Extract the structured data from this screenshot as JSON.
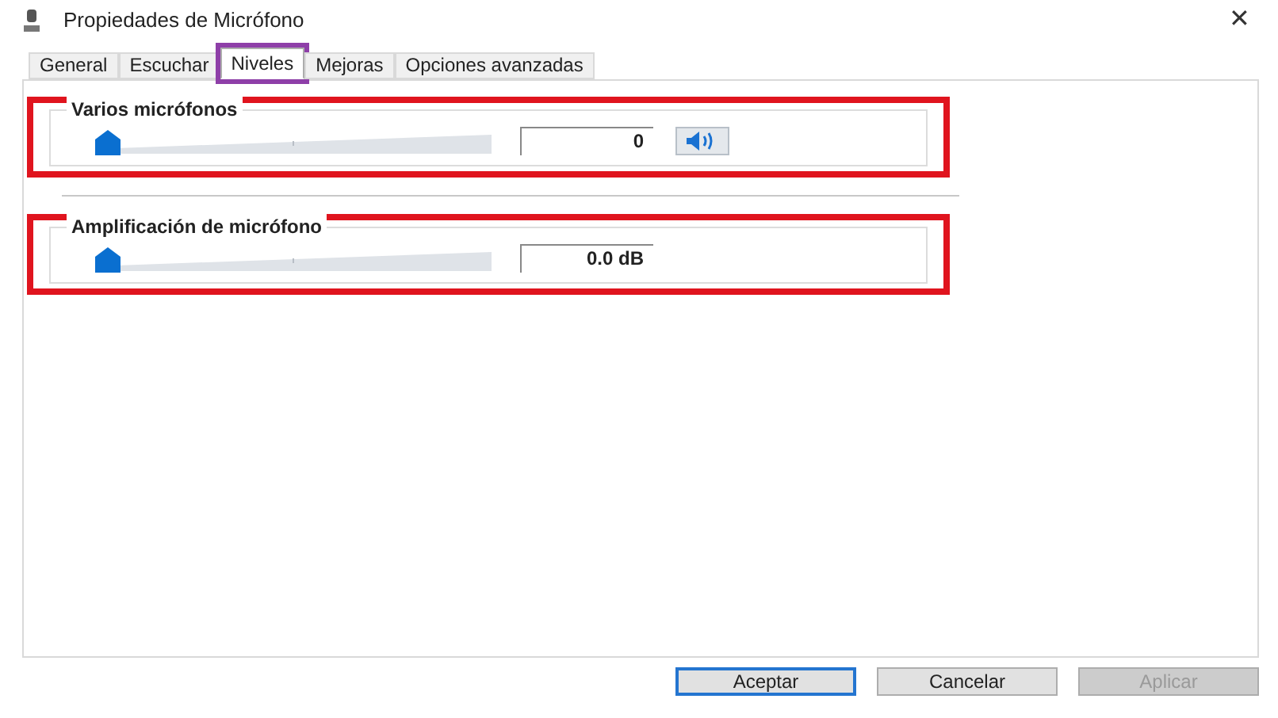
{
  "window": {
    "title": "Propiedades de Micrófono",
    "close": "✕"
  },
  "tabs": [
    {
      "label": "General",
      "selected": false,
      "highlighted": false
    },
    {
      "label": "Escuchar",
      "selected": false,
      "highlighted": false
    },
    {
      "label": "Niveles",
      "selected": true,
      "highlighted": true
    },
    {
      "label": "Mejoras",
      "selected": false,
      "highlighted": false
    },
    {
      "label": "Opciones avanzadas",
      "selected": false,
      "highlighted": false
    }
  ],
  "levels": [
    {
      "label": "Varios micrófonos",
      "level": 0,
      "reading": "0",
      "mute_button": true,
      "highlighted": true
    },
    {
      "label": "Amplificación de micrófono",
      "level": 0,
      "reading": "0.0 dB",
      "mute_button": false,
      "highlighted": true
    }
  ],
  "buttons": [
    {
      "label": "Aceptar",
      "default": true,
      "disabled": false
    },
    {
      "label": "Cancelar",
      "default": false,
      "disabled": false
    },
    {
      "label": "Aplicar",
      "default": false,
      "disabled": true
    }
  ]
}
